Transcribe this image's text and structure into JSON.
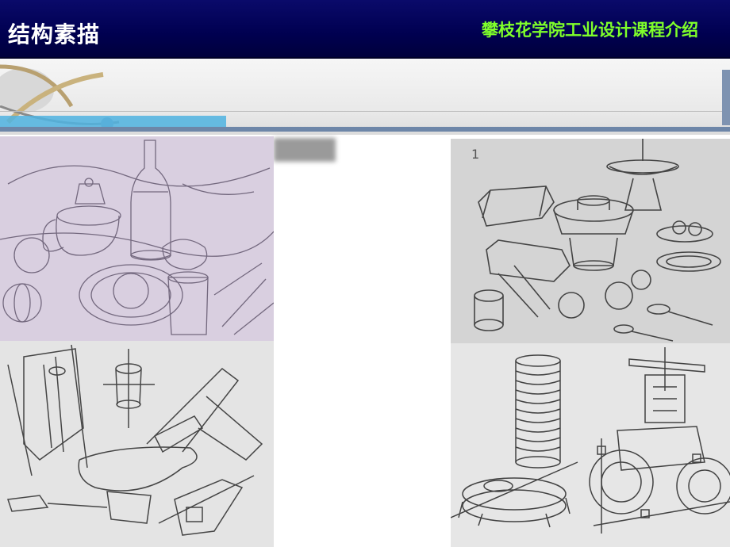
{
  "header": {
    "title": "结构素描",
    "subtitle": "攀枝花学院工业设计课程介绍"
  },
  "panels": {
    "top_right_number": "1"
  },
  "colors": {
    "header_bg": "#00004e",
    "subtitle": "#7fff2a",
    "accent_stripe": "#4fb3e0"
  }
}
